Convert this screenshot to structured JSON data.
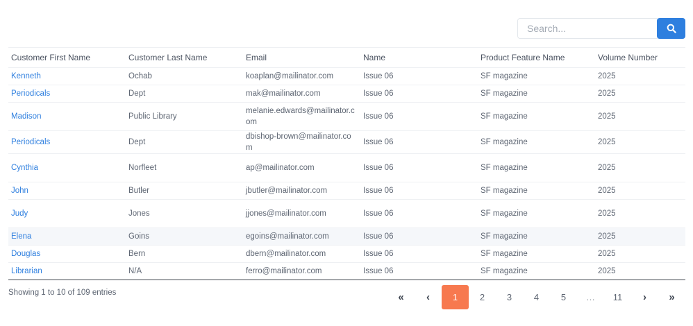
{
  "search": {
    "placeholder": "Search..."
  },
  "table": {
    "headers": [
      "Customer First Name",
      "Customer Last Name",
      "Email",
      "Name",
      "Product Feature Name",
      "Volume Number"
    ],
    "rows": [
      [
        "Kenneth",
        "Ochab",
        "koaplan@mailinator.com",
        "Issue 06",
        "SF magazine",
        "2025"
      ],
      [
        "Periodicals",
        "Dept",
        "mak@mailinator.com",
        "Issue 06",
        "SF magazine",
        "2025"
      ],
      [
        "Madison",
        "Public Library",
        "melanie.edwards@mailinator.com",
        "Issue 06",
        "SF magazine",
        "2025"
      ],
      [
        "Periodicals",
        "Dept",
        "dbishop-brown@mailinator.com",
        "Issue 06",
        "SF magazine",
        "2025"
      ],
      [
        "Cynthia",
        "Norfleet",
        "ap@mailinator.com",
        "Issue 06",
        "SF magazine",
        "2025"
      ],
      [
        "John",
        "Butler",
        "jbutler@mailinator.com",
        "Issue 06",
        "SF magazine",
        "2025"
      ],
      [
        "Judy",
        "Jones",
        "jjones@mailinator.com",
        "Issue 06",
        "SF magazine",
        "2025"
      ],
      [
        "Elena",
        "Goins",
        "egoins@mailinator.com",
        "Issue 06",
        "SF magazine",
        "2025"
      ],
      [
        "Douglas",
        "Bern",
        "dbern@mailinator.com",
        "Issue 06",
        "SF magazine",
        "2025"
      ],
      [
        "Librarian",
        "N/A",
        "ferro@mailinator.com",
        "Issue 06",
        "SF magazine",
        "2025"
      ]
    ]
  },
  "info": "Showing 1 to 10 of 109 entries",
  "pagination": {
    "first": "«",
    "prev": "‹",
    "pages": [
      "1",
      "2",
      "3",
      "4",
      "5"
    ],
    "ellipsis": "…",
    "last_page": "11",
    "next": "›",
    "last": "»",
    "active_page": "1"
  },
  "colors": {
    "accent": "#2e7fdf",
    "active_page": "#f7794f"
  }
}
